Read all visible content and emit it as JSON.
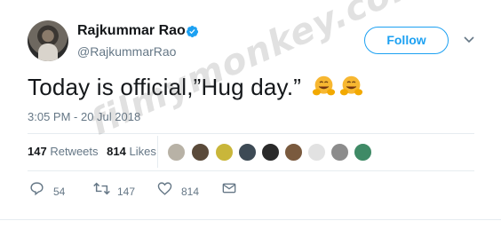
{
  "profile": {
    "name": "Rajkummar Rao",
    "handle": "@RajkummarRao",
    "verified": true
  },
  "follow_button": {
    "label": "Follow"
  },
  "tweet": {
    "text": "Today is official,”Hug day.”",
    "emojis": [
      "hugging-face-emoji",
      "hugging-face-emoji"
    ],
    "timestamp": "3:05 PM - 20 Jul 2018"
  },
  "stats": {
    "retweets_count": "147",
    "retweets_label": "Retweets",
    "likes_count": "814",
    "likes_label": "Likes"
  },
  "actions": {
    "reply_count": "54",
    "retweet_count": "147",
    "like_count": "814"
  },
  "watermark": "filmymonkey.com",
  "colors": {
    "accent": "#1da1f2",
    "text": "#14171a",
    "muted": "#657786",
    "divider": "#e6ecf0"
  }
}
